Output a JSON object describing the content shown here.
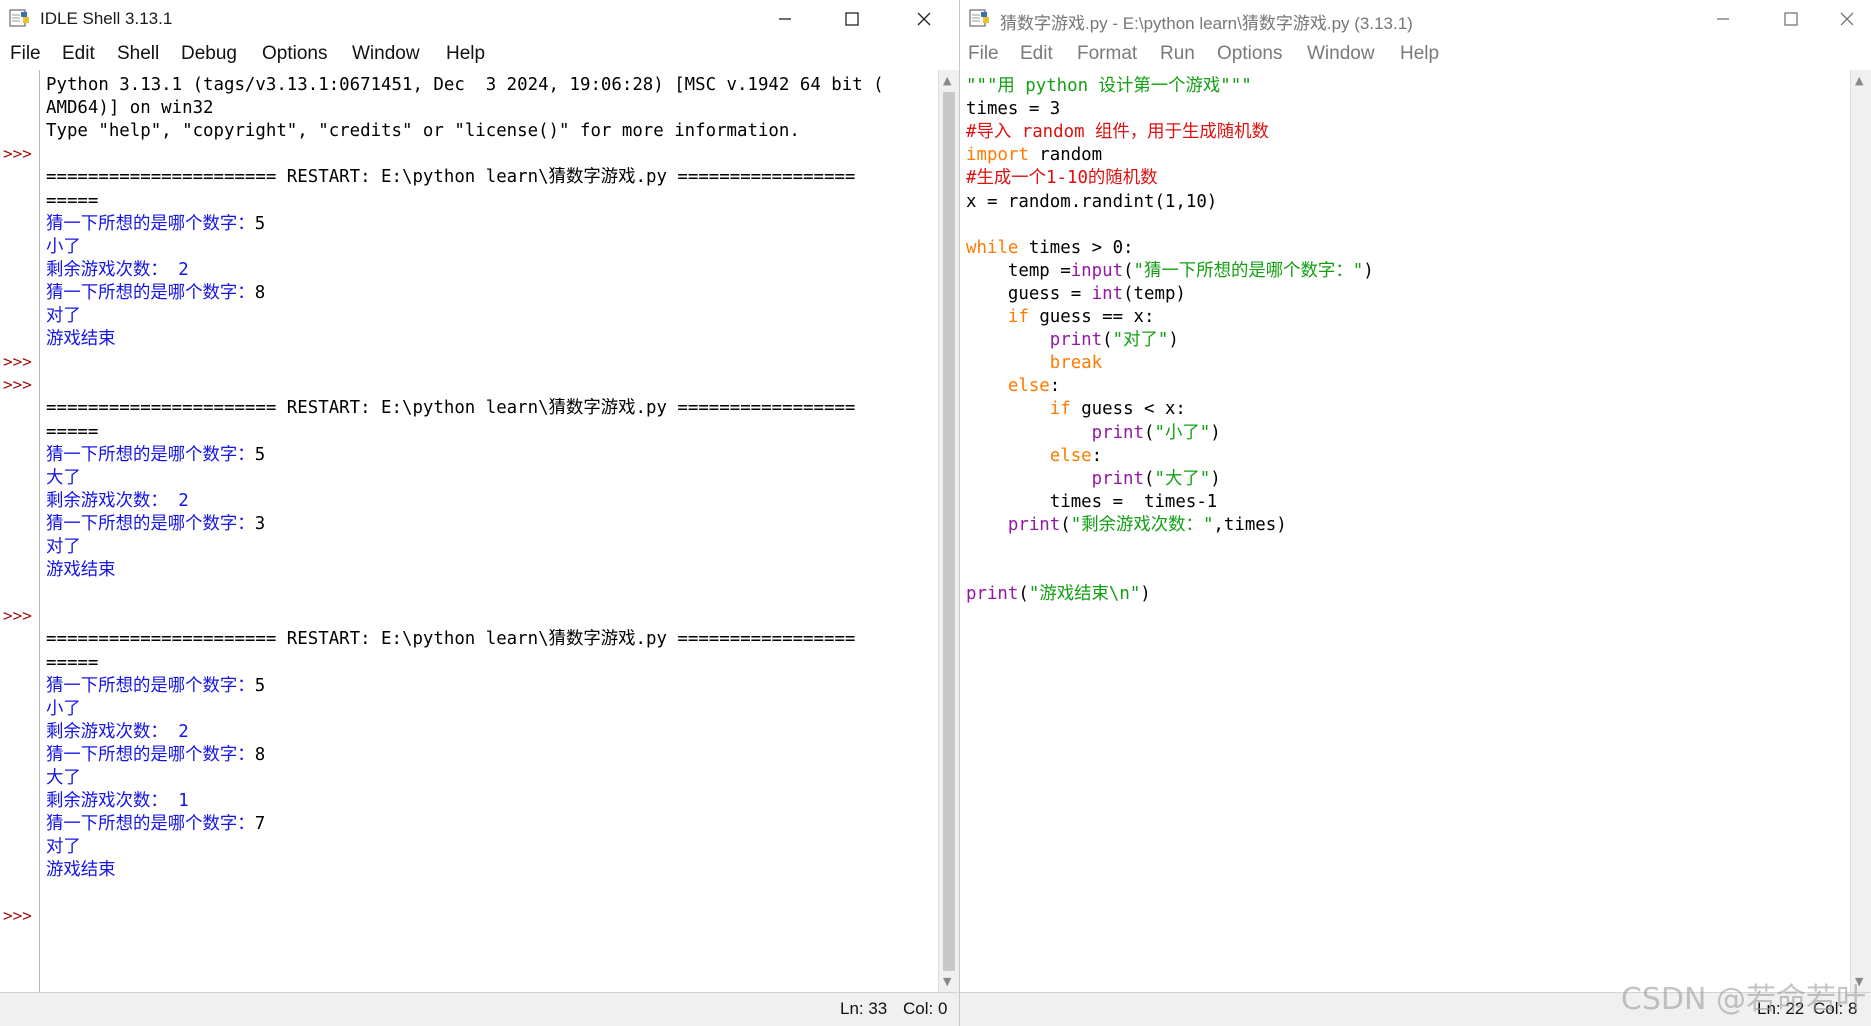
{
  "colors": {
    "output": "#1515e6",
    "prompt": "#a10f0f",
    "string": "#12a012",
    "keyword": "#ff7a00",
    "builtin": "#9417a4",
    "comment": "#dd1111"
  },
  "shell": {
    "title": "IDLE Shell 3.13.1",
    "menu": [
      "File",
      "Edit",
      "Shell",
      "Debug",
      "Options",
      "Window",
      "Help"
    ],
    "prompts": [
      ">>>",
      ">>>",
      ">>>",
      ">>>",
      ">>>"
    ],
    "lines": [
      {
        "t": "Python 3.13.1 (tags/v3.13.1:0671451, Dec  3 2024, 19:06:28) [MSC v.1942 64 bit (",
        "c": "def"
      },
      {
        "t": "AMD64)] on win32",
        "c": "def"
      },
      {
        "t": "Type \"help\", \"copyright\", \"credits\" or \"license()\" for more information.",
        "c": "def"
      },
      {
        "t": "",
        "c": "def"
      },
      {
        "t": "====================== RESTART: E:\\python learn\\猜数字游戏.py =================",
        "c": "def"
      },
      {
        "t": "=====",
        "c": "def"
      },
      {
        "t": "猜一下所想的是哪个数字：",
        "c": "out",
        "in": "5"
      },
      {
        "t": "小了",
        "c": "out"
      },
      {
        "t": "剩余游戏次数： 2",
        "c": "out"
      },
      {
        "t": "猜一下所想的是哪个数字：",
        "c": "out",
        "in": "8"
      },
      {
        "t": "对了",
        "c": "out"
      },
      {
        "t": "游戏结束",
        "c": "out"
      },
      {
        "t": "",
        "c": "def"
      },
      {
        "t": "",
        "c": "def"
      },
      {
        "t": "====================== RESTART: E:\\python learn\\猜数字游戏.py =================",
        "c": "def"
      },
      {
        "t": "=====",
        "c": "def"
      },
      {
        "t": "猜一下所想的是哪个数字：",
        "c": "out",
        "in": "5"
      },
      {
        "t": "大了",
        "c": "out"
      },
      {
        "t": "剩余游戏次数： 2",
        "c": "out"
      },
      {
        "t": "猜一下所想的是哪个数字：",
        "c": "out",
        "in": "3"
      },
      {
        "t": "对了",
        "c": "out"
      },
      {
        "t": "游戏结束",
        "c": "out"
      },
      {
        "t": "",
        "c": "def"
      },
      {
        "t": "",
        "c": "def"
      },
      {
        "t": "====================== RESTART: E:\\python learn\\猜数字游戏.py =================",
        "c": "def"
      },
      {
        "t": "=====",
        "c": "def"
      },
      {
        "t": "猜一下所想的是哪个数字：",
        "c": "out",
        "in": "5"
      },
      {
        "t": "小了",
        "c": "out"
      },
      {
        "t": "剩余游戏次数： 2",
        "c": "out"
      },
      {
        "t": "猜一下所想的是哪个数字：",
        "c": "out",
        "in": "8"
      },
      {
        "t": "大了",
        "c": "out"
      },
      {
        "t": "剩余游戏次数： 1",
        "c": "out"
      },
      {
        "t": "猜一下所想的是哪个数字：",
        "c": "out",
        "in": "7"
      },
      {
        "t": "对了",
        "c": "out"
      },
      {
        "t": "游戏结束",
        "c": "out"
      }
    ],
    "status": {
      "ln": "Ln: 33",
      "col": "Col: 0"
    }
  },
  "editor": {
    "title": "猜数字游戏.py - E:\\python learn\\猜数字游戏.py (3.13.1)",
    "menu": [
      "File",
      "Edit",
      "Format",
      "Run",
      "Options",
      "Window",
      "Help"
    ],
    "lines": [
      [
        {
          "t": "\"\"\"用 python 设计第一个游戏\"\"\"",
          "c": "str"
        }
      ],
      [
        {
          "t": "times = 3",
          "c": "def"
        }
      ],
      [
        {
          "t": "#导入 random 组件，用于生成随机数",
          "c": "cm"
        }
      ],
      [
        {
          "t": "import",
          "c": "kw"
        },
        {
          "t": " random",
          "c": "def"
        }
      ],
      [
        {
          "t": "#生成一个1-10的随机数",
          "c": "cm"
        }
      ],
      [
        {
          "t": "x = random.randint(1,10)",
          "c": "def"
        }
      ],
      [],
      [
        {
          "t": "while",
          "c": "kw"
        },
        {
          "t": " times > 0:",
          "c": "def"
        }
      ],
      [
        {
          "t": "    temp =",
          "c": "def"
        },
        {
          "t": "input",
          "c": "bi"
        },
        {
          "t": "(",
          "c": "def"
        },
        {
          "t": "\"猜一下所想的是哪个数字：\"",
          "c": "str"
        },
        {
          "t": ")",
          "c": "def"
        }
      ],
      [
        {
          "t": "    guess = ",
          "c": "def"
        },
        {
          "t": "int",
          "c": "bi"
        },
        {
          "t": "(temp)",
          "c": "def"
        }
      ],
      [
        {
          "t": "    ",
          "c": "def"
        },
        {
          "t": "if",
          "c": "kw"
        },
        {
          "t": " guess == x:",
          "c": "def"
        }
      ],
      [
        {
          "t": "        ",
          "c": "def"
        },
        {
          "t": "print",
          "c": "bi"
        },
        {
          "t": "(",
          "c": "def"
        },
        {
          "t": "\"对了\"",
          "c": "str"
        },
        {
          "t": ")",
          "c": "def"
        }
      ],
      [
        {
          "t": "        ",
          "c": "def"
        },
        {
          "t": "break",
          "c": "kw"
        }
      ],
      [
        {
          "t": "    ",
          "c": "def"
        },
        {
          "t": "else",
          "c": "kw"
        },
        {
          "t": ":",
          "c": "def"
        }
      ],
      [
        {
          "t": "        ",
          "c": "def"
        },
        {
          "t": "if",
          "c": "kw"
        },
        {
          "t": " guess < x:",
          "c": "def"
        }
      ],
      [
        {
          "t": "            ",
          "c": "def"
        },
        {
          "t": "print",
          "c": "bi"
        },
        {
          "t": "(",
          "c": "def"
        },
        {
          "t": "\"小了\"",
          "c": "str"
        },
        {
          "t": ")",
          "c": "def"
        }
      ],
      [
        {
          "t": "        ",
          "c": "def"
        },
        {
          "t": "else",
          "c": "kw"
        },
        {
          "t": ":",
          "c": "def"
        }
      ],
      [
        {
          "t": "            ",
          "c": "def"
        },
        {
          "t": "print",
          "c": "bi"
        },
        {
          "t": "(",
          "c": "def"
        },
        {
          "t": "\"大了\"",
          "c": "str"
        },
        {
          "t": ")",
          "c": "def"
        }
      ],
      [
        {
          "t": "        times =  times-1",
          "c": "def"
        }
      ],
      [
        {
          "t": "    ",
          "c": "def"
        },
        {
          "t": "print",
          "c": "bi"
        },
        {
          "t": "(",
          "c": "def"
        },
        {
          "t": "\"剩余游戏次数：\"",
          "c": "str"
        },
        {
          "t": ",times)",
          "c": "def"
        }
      ],
      [],
      [],
      [
        {
          "t": "print",
          "c": "bi"
        },
        {
          "t": "(",
          "c": "def"
        },
        {
          "t": "\"游戏结束\\n\"",
          "c": "str"
        },
        {
          "t": ")",
          "c": "def"
        }
      ]
    ],
    "status": {
      "ln": "Ln: 22",
      "col": "Col: 8"
    }
  },
  "watermark": "CSDN @若命若叶"
}
